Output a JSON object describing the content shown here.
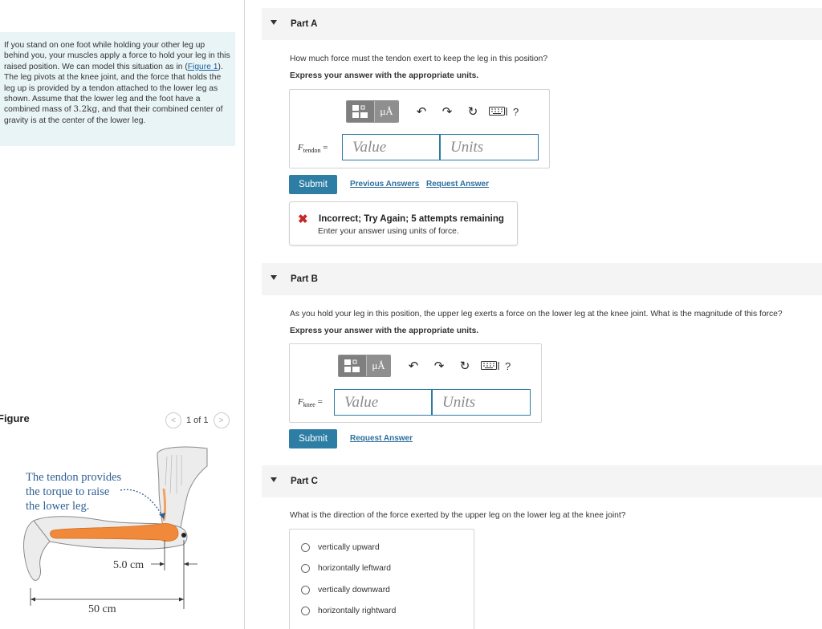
{
  "problem": {
    "text_1": "If you stand on one foot while holding your other leg up behind you, your muscles apply a force to hold your leg in this raised position. We can model this situation as in (",
    "figure_link": "Figure 1",
    "text_2": "). The leg pivots at the knee joint, and the force that holds the leg up is provided by a tendon attached to the lower leg as shown. Assume that the lower leg and the foot have a combined mass of ",
    "mass": "3.2kg",
    "text_3": ", and that their combined center of gravity is at the center of the lower leg."
  },
  "figure": {
    "header": "Figure",
    "pager": "1 of 1",
    "caption_1": "The tendon provides",
    "caption_2": "the torque to raise",
    "caption_3": "the lower leg.",
    "dim_short": "5.0 cm",
    "dim_long": "50 cm"
  },
  "parts": {
    "a": {
      "title": "Part A",
      "question": "How much force must the tendon exert to keep the leg in this position?",
      "instruction": "Express your answer with the appropriate units.",
      "var_main": "F",
      "var_sub": "tendon",
      "equals": "=",
      "value_placeholder": "Value",
      "units_placeholder": "Units",
      "submit": "Submit",
      "previous_answers": "Previous Answers",
      "request_answer": "Request Answer",
      "feedback_title": "Incorrect; Try Again; 5 attempts remaining",
      "feedback_msg": "Enter your answer using units of force."
    },
    "b": {
      "title": "Part B",
      "question": "As you hold your leg in this position, the upper leg exerts a force on the lower leg at the knee joint. What is the magnitude of this force?",
      "instruction": "Express your answer with the appropriate units.",
      "var_main": "F",
      "var_sub": "knee",
      "equals": "=",
      "value_placeholder": "Value",
      "units_placeholder": "Units",
      "submit": "Submit",
      "request_answer": "Request Answer"
    },
    "c": {
      "title": "Part C",
      "question": "What is the direction of the force exerted by the upper leg on the lower leg at the knee joint?",
      "options": [
        "vertically upward",
        "horizontally leftward",
        "vertically downward",
        "horizontally rightward"
      ]
    }
  },
  "toolbar": {
    "units_symbol": "μÅ",
    "help": "?"
  },
  "colors": {
    "accent": "#2d7da5",
    "problem_bg": "#e9f4f6",
    "error": "#c62828",
    "bone": "#f08a3a"
  }
}
